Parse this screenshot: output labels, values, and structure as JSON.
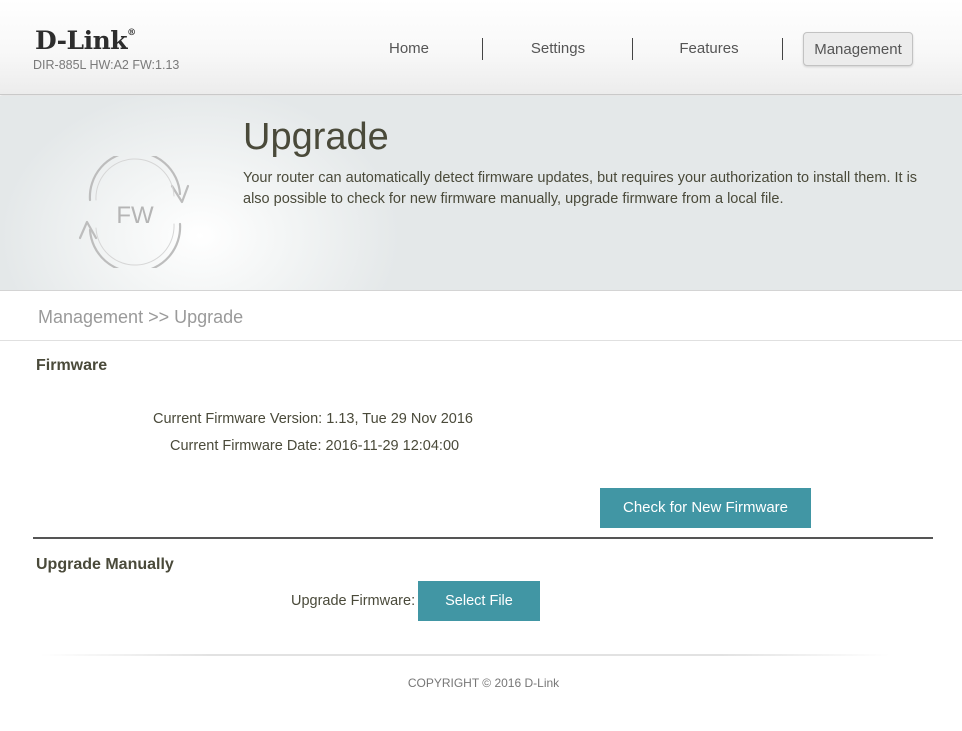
{
  "header": {
    "logo": "D-Link",
    "logo_mark": "®",
    "model_info": "DIR-885L HW:A2 FW:1.13"
  },
  "nav": {
    "items": [
      {
        "label": "Home"
      },
      {
        "label": "Settings"
      },
      {
        "label": "Features"
      },
      {
        "label": "Management"
      }
    ],
    "active": "Management"
  },
  "banner": {
    "icon": "fw-refresh-icon",
    "icon_text": "FW",
    "title": "Upgrade",
    "description": "Your router can automatically detect firmware updates, but requires your authorization to install them. It is also possible to check for new firmware manually, upgrade firmware from a local file."
  },
  "breadcrumb": "Management >> Upgrade",
  "firmware": {
    "section_title": "Firmware",
    "version_label": "Current Firmware Version:",
    "version_value": "1.13, Tue 29 Nov 2016",
    "date_label": "Current Firmware Date:",
    "date_value": "2016-11-29 12:04:00",
    "check_button": "Check for New Firmware"
  },
  "manual": {
    "section_title": "Upgrade Manually",
    "upgrade_label": "Upgrade Firmware:",
    "select_button": "Select File"
  },
  "footer": {
    "copyright": "COPYRIGHT © 2016 D-Link"
  },
  "colors": {
    "accent_button": "#4196a4",
    "text": "#4a4a3a",
    "muted": "#9a9a9a"
  }
}
